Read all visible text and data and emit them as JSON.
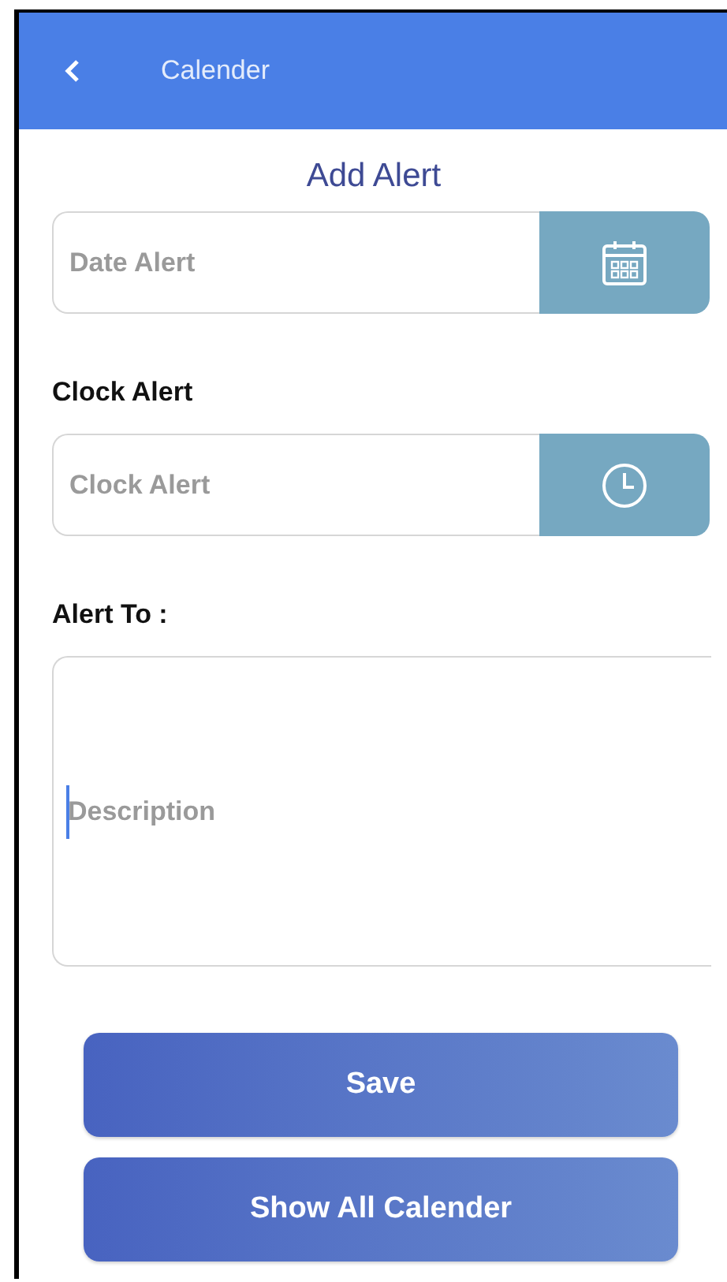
{
  "header": {
    "title": "Calender"
  },
  "heading": "Add Alert",
  "date_field": {
    "placeholder": "Date Alert"
  },
  "clock_label": "Clock Alert",
  "clock_field": {
    "placeholder": "Clock Alert"
  },
  "alert_to_label": "Alert To :",
  "description_field": {
    "placeholder": "Description",
    "focused": true
  },
  "buttons": [
    "Save",
    "Show All Calender"
  ]
}
